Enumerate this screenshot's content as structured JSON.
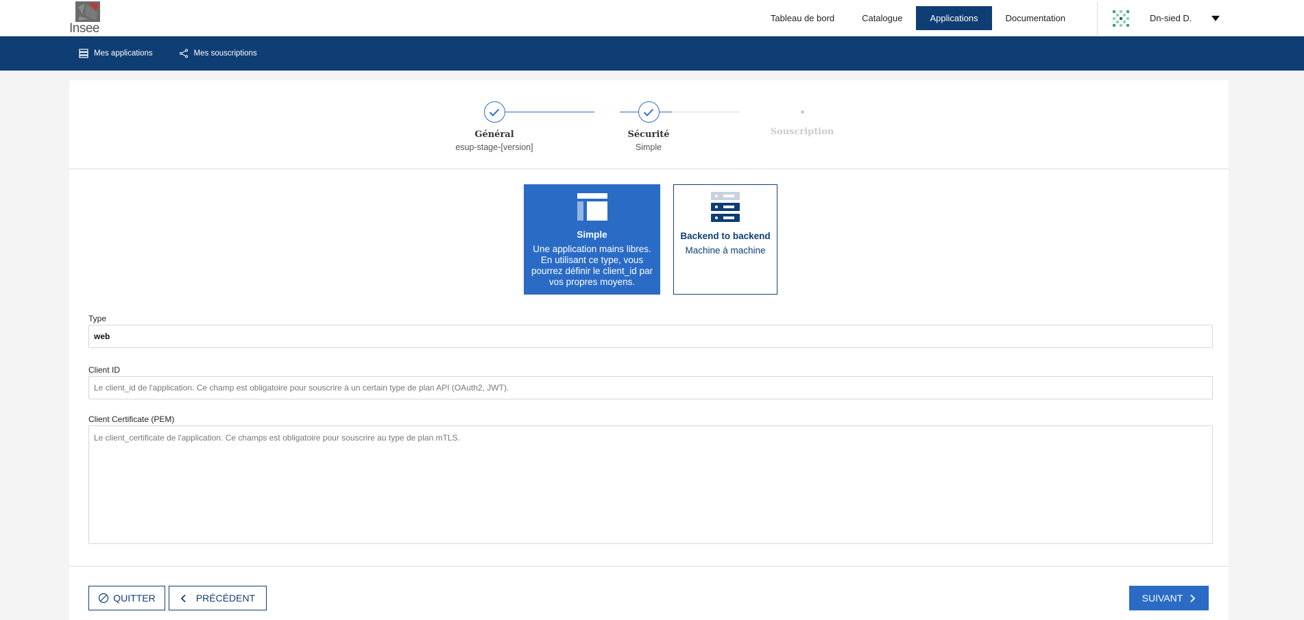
{
  "header": {
    "logo_text": "Insee",
    "nav": [
      {
        "label": "Tableau de bord"
      },
      {
        "label": "Catalogue"
      },
      {
        "label": "Applications"
      },
      {
        "label": "Documentation"
      }
    ],
    "user_name": "Dn-sied D."
  },
  "subnav": {
    "items": [
      {
        "label": "Mes applications"
      },
      {
        "label": "Mes souscriptions"
      }
    ]
  },
  "stepper": {
    "steps": [
      {
        "title": "Général",
        "subtitle": "esup-stage-[version]"
      },
      {
        "title": "Sécurité",
        "subtitle": "Simple"
      },
      {
        "title": "Souscription",
        "subtitle": ""
      }
    ]
  },
  "types": {
    "simple": {
      "title": "Simple",
      "description": "Une application mains libres. En utilisant ce type, vous pourrez définir le client_id par vos propres moyens."
    },
    "backend": {
      "title": "Backend to backend",
      "description": "Machine à machine"
    }
  },
  "form": {
    "type_label": "Type",
    "type_value": "web",
    "client_id_label": "Client ID",
    "client_id_placeholder": "Le client_id de l'application. Ce champ est obligatoire pour souscrire à un certain type de plan API (OAuth2, JWT).",
    "cert_label": "Client Certificate (PEM)",
    "cert_placeholder": "Le client_certificate de l'application. Ce champs est obligatoire pour souscrire au type de plan mTLS."
  },
  "actions": {
    "quit_label": "QUITTER",
    "prev_label": "PRÉCÉDENT",
    "next_label": "SUIVANT"
  },
  "colors": {
    "primary_dark": "#0e3e73",
    "primary": "#2a6bc5"
  }
}
